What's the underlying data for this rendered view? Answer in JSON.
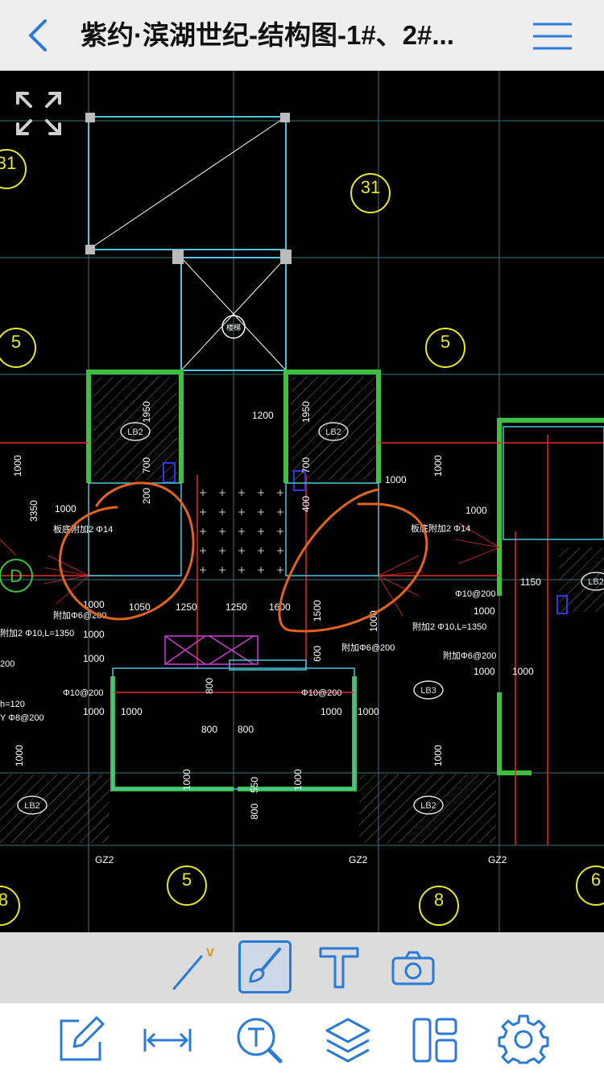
{
  "nav": {
    "title": "紫约·滨湖世纪-结构图-1#、2#...",
    "back_icon": "chevron-left-icon",
    "menu_icon": "hamburger-menu-icon",
    "accent": "#2a7ad8"
  },
  "canvas": {
    "expand_icon": "expand-arrows-icon",
    "labels": {
      "room_lb2": "LB2",
      "room_lb3": "LB3",
      "gz2": "GZ2",
      "axis_5": "5",
      "axis_8": "8",
      "axis_31": "31",
      "axis_6": "6",
      "axis_d": "D",
      "stair": "楼梯",
      "dim_1200": "1200",
      "dim_1950": "1950",
      "dim_1000": "1000",
      "dim_700": "700",
      "dim_200": "200",
      "dim_400": "400",
      "dim_3350": "3350",
      "dim_1050": "1050",
      "dim_1250": "1250",
      "dim_1600": "1600",
      "dim_1500": "1500",
      "dim_600": "600",
      "dim_800": "800",
      "dim_550": "550",
      "dim_1150": "1150",
      "note_rebar_a": "板底附加2 Φ14",
      "note_rebar_b": "板底附加2 Φ14",
      "note_phi10": "Φ10@200",
      "note_l1350": "附加2 Φ10,L=1350",
      "note_fu6": "附加Φ6@200",
      "note_h120": "h=120",
      "note_y8": "Y Φ8@200",
      "note_200": "200"
    }
  },
  "toolbar_top": {
    "line_tool_icon": "line-tool-icon",
    "brush_tool_icon": "brush-tool-icon",
    "text_tool_icon": "text-tool-icon",
    "camera_tool_icon": "camera-icon",
    "line_badge": "v"
  },
  "toolbar_bottom": {
    "edit_icon": "edit-note-icon",
    "measure_icon": "measure-distance-icon",
    "text_search_icon": "text-search-icon",
    "layers_icon": "layers-icon",
    "layout_icon": "layout-panels-icon",
    "settings_icon": "settings-gear-icon"
  }
}
